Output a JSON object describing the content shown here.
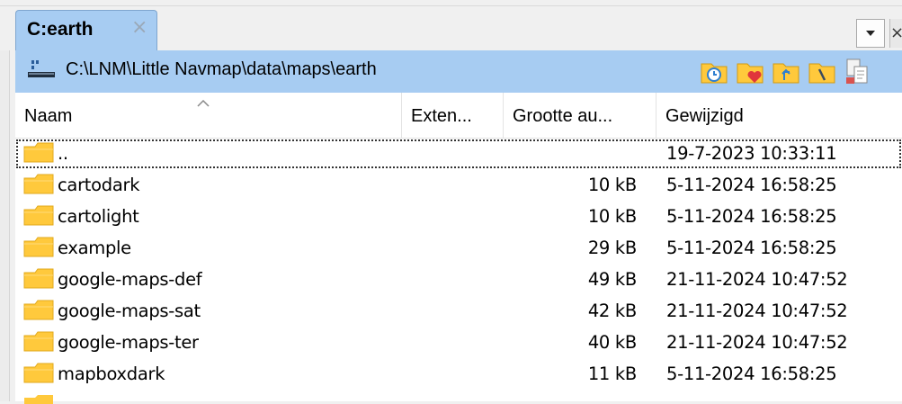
{
  "tab": {
    "title": "C:earth",
    "close_glyph": "×"
  },
  "pathbar": {
    "path": "C:\\LNM\\Little Navmap\\data\\maps\\earth",
    "drive_icon": "drive-icon",
    "buttons": [
      "history-icon",
      "favorites-icon",
      "parent-folder-icon",
      "root-folder-icon",
      "copy-path-icon"
    ]
  },
  "columns": {
    "name": "Naam",
    "ext": "Exten...",
    "size": "Grootte au...",
    "modified": "Gewijzigd"
  },
  "rows": [
    {
      "name": "..",
      "size": "",
      "modified": "19-7-2023 10:33:11"
    },
    {
      "name": "cartodark",
      "size": "10 kB",
      "modified": "5-11-2024 16:58:25"
    },
    {
      "name": "cartolight",
      "size": "10 kB",
      "modified": "5-11-2024 16:58:25"
    },
    {
      "name": "example",
      "size": "29 kB",
      "modified": "5-11-2024 16:58:25"
    },
    {
      "name": "google-maps-def",
      "size": "49 kB",
      "modified": "21-11-2024 10:47:52"
    },
    {
      "name": "google-maps-sat",
      "size": "42 kB",
      "modified": "21-11-2024 10:47:52"
    },
    {
      "name": "google-maps-ter",
      "size": "40 kB",
      "modified": "21-11-2024 10:47:52"
    },
    {
      "name": "mapboxdark",
      "size": "11 kB",
      "modified": "5-11-2024 16:58:25"
    }
  ],
  "colors": {
    "accent": "#a7ccf2",
    "folder": "#ffc93c"
  }
}
